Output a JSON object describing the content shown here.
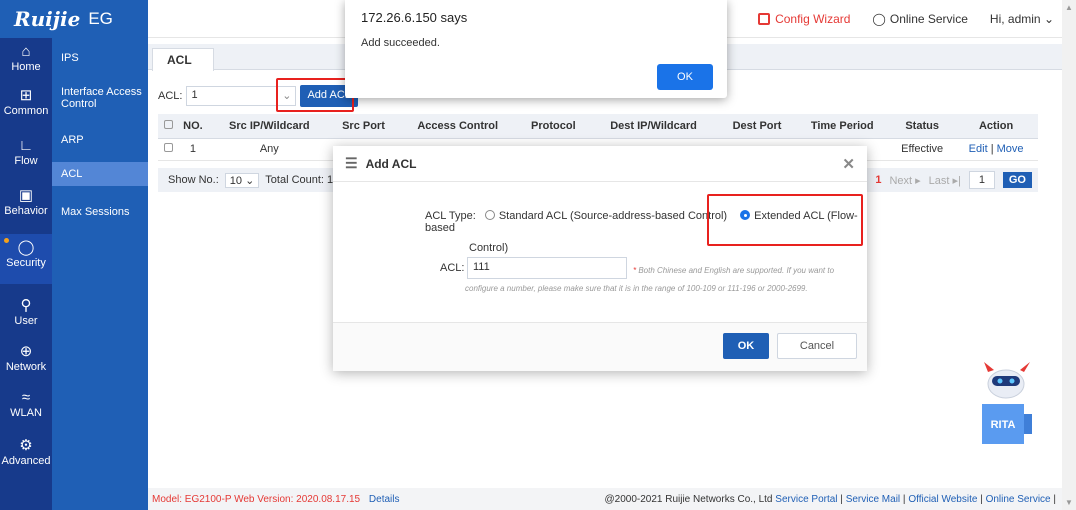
{
  "brand": {
    "name": "Ruijie",
    "product": "EG"
  },
  "topbar": {
    "help_glyph": "?",
    "config_wizard": "Config Wizard",
    "online_service": "Online Service",
    "user": "Hi, admin"
  },
  "left_nav": [
    {
      "label": "Home",
      "icon": "home-icon"
    },
    {
      "label": "Common",
      "icon": "common-icon"
    },
    {
      "label": "Flow",
      "icon": "flow-icon"
    },
    {
      "label": "Behavior",
      "icon": "behavior-icon"
    },
    {
      "label": "Security",
      "icon": "shield-icon"
    },
    {
      "label": "User",
      "icon": "user-icon"
    },
    {
      "label": "Network",
      "icon": "network-icon"
    },
    {
      "label": "WLAN",
      "icon": "wifi-icon"
    },
    {
      "label": "Advanced",
      "icon": "gear-icon"
    }
  ],
  "sub_nav": [
    {
      "label": "IPS"
    },
    {
      "label": "Interface Access Control"
    },
    {
      "label": "ARP"
    },
    {
      "label": "ACL"
    },
    {
      "label": "Max Sessions"
    }
  ],
  "tab": {
    "label": "ACL"
  },
  "filter": {
    "label": "ACL:",
    "value": "1",
    "add_button": "Add ACL"
  },
  "table": {
    "columns": [
      "NO.",
      "Src IP/Wildcard",
      "Src Port",
      "Access Control",
      "Protocol",
      "Dest IP/Wildcard",
      "Dest Port",
      "Time Period",
      "Status",
      "Action"
    ],
    "rows": [
      {
        "no": "1",
        "src_ip": "Any",
        "status": "Effective",
        "edit": "Edit",
        "move": "Move"
      }
    ]
  },
  "pager": {
    "show_label": "Show No.:",
    "per_page": "10",
    "total": "Total Count: 1",
    "current": "1",
    "next": "Next",
    "last": "Last",
    "page_input": "1",
    "go": "GO"
  },
  "alert": {
    "title": "172.26.6.150 says",
    "message": "Add succeeded.",
    "ok": "OK"
  },
  "modal": {
    "title": "Add ACL",
    "type_label": "ACL Type:",
    "option_standard": "Standard ACL (Source-address-based Control)",
    "option_extended_1": "Extended ACL (Flow-based",
    "option_extended_2": "Control)",
    "acl_label": "ACL:",
    "acl_value": "111",
    "hint_1": "Both Chinese and English are supported. If you want to",
    "hint_2": "configure a number, please make sure that it is in the range of 100-109 or 111-196 or 2000-2699.",
    "ok": "OK",
    "cancel": "Cancel"
  },
  "mascot": {
    "label": "RITA"
  },
  "footer": {
    "model": "Model: EG2100-P",
    "version": "Web Version: 2020.08.17.15",
    "details": "Details",
    "copyright": "@2000-2021 Ruijie Networks Co., Ltd",
    "links": [
      "Service Portal",
      "Service Mail",
      "Official Website",
      "Online Service"
    ]
  },
  "colors": {
    "brand_blue": "#1f5fb5",
    "dark_nav": "#173a8b",
    "highlight_red": "#e8211e"
  }
}
